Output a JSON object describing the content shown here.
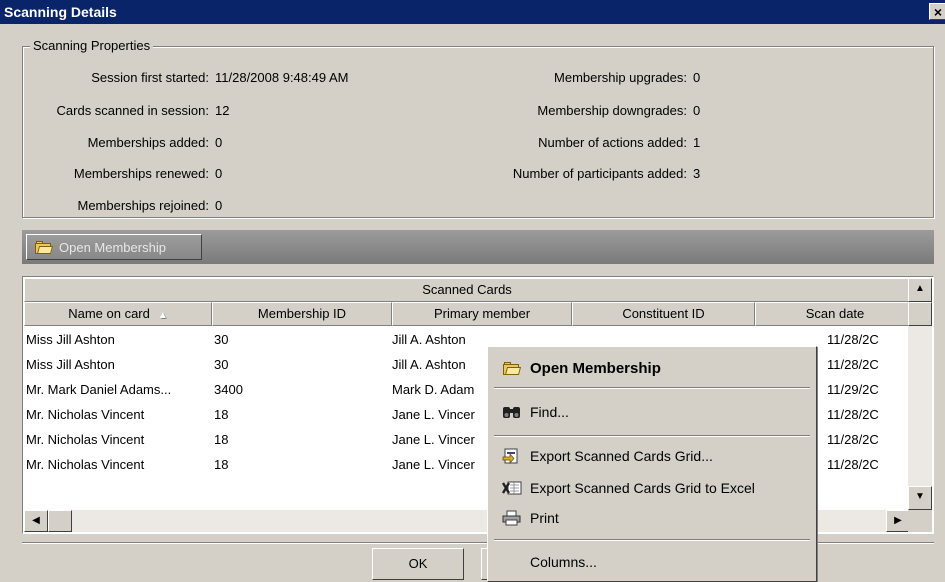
{
  "window": {
    "title": "Scanning Details",
    "close_glyph": "×"
  },
  "properties": {
    "legend": "Scanning Properties",
    "left": [
      {
        "label": "Session first started:",
        "value": "11/28/2008 9:48:49 AM"
      },
      {
        "label": "Cards scanned in session:",
        "value": "12"
      },
      {
        "label": "Memberships added:",
        "value": "0"
      },
      {
        "label": "Memberships renewed:",
        "value": "0"
      },
      {
        "label": "Memberships rejoined:",
        "value": "0"
      }
    ],
    "right": [
      {
        "label": "Membership upgrades:",
        "value": "0"
      },
      {
        "label": "Membership downgrades:",
        "value": "0"
      },
      {
        "label": "Number of actions added:",
        "value": "1"
      },
      {
        "label": "Number of participants added:",
        "value": "3"
      }
    ]
  },
  "toolbar": {
    "open_membership_label": "Open Membership"
  },
  "grid": {
    "band_title": "Scanned Cards",
    "columns": [
      "Name on card",
      "Membership ID",
      "Primary member",
      "Constituent ID",
      "Scan date"
    ],
    "sort_glyph": "▲",
    "rows": [
      [
        "Miss Jill Ashton",
        "30",
        "Jill A. Ashton",
        "",
        "11/28/2C"
      ],
      [
        "Miss Jill Ashton",
        "30",
        "Jill A. Ashton",
        "",
        "11/28/2C"
      ],
      [
        "Mr. Mark Daniel Adams...",
        "3400",
        "Mark D. Adam",
        "",
        "11/29/2C"
      ],
      [
        "Mr. Nicholas Vincent",
        "18",
        "Jane L. Vincer",
        "",
        "11/28/2C"
      ],
      [
        "Mr. Nicholas Vincent",
        "18",
        "Jane L. Vincer",
        "",
        "11/28/2C"
      ],
      [
        "Mr. Nicholas Vincent",
        "18",
        "Jane L. Vincer",
        "",
        "11/28/2C"
      ]
    ]
  },
  "buttons": {
    "ok_label": "OK"
  },
  "context_menu": {
    "open_membership": "Open Membership",
    "find": "Find...",
    "export_grid": "Export Scanned Cards Grid...",
    "export_excel": "Export Scanned Cards Grid to Excel",
    "print": "Print",
    "columns": "Columns..."
  }
}
